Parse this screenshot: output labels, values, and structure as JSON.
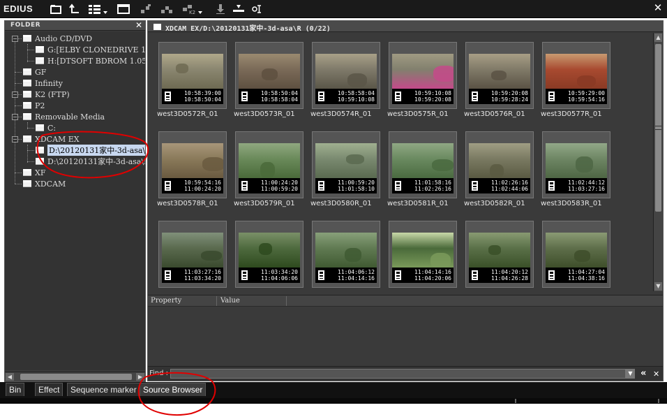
{
  "app": {
    "title": "EDIUS",
    "close_glyph": "✕"
  },
  "toolbar": {
    "icons": [
      "folder-open-icon",
      "up-folder-icon",
      "view-mode-icon",
      "window-icon",
      "add-to-bin-icon",
      "transfer-icon",
      "k2-icon",
      "import-icon",
      "insert-icon",
      "settings-icon"
    ]
  },
  "folder_panel": {
    "title": "FOLDER",
    "close_glyph": "✕",
    "tree": [
      {
        "label": "Audio CD/DVD",
        "level": 0,
        "expandable": true
      },
      {
        "label": "G:[ELBY CLONEDRIVE 1.4",
        "level": 1
      },
      {
        "label": "H:[DTSOFT BDROM 1.05]",
        "level": 1
      },
      {
        "label": "GF",
        "level": 0
      },
      {
        "label": "Infinity",
        "level": 0
      },
      {
        "label": "K2 (FTP)",
        "level": 0,
        "expandable": true
      },
      {
        "label": "P2",
        "level": 0
      },
      {
        "label": "Removable Media",
        "level": 0,
        "expandable": true
      },
      {
        "label": "C:",
        "level": 1
      },
      {
        "label": "XDCAM EX",
        "level": 0,
        "expandable": true
      },
      {
        "label": "D:\\20120131家中-3d-asa\\R",
        "level": 1,
        "selected": true
      },
      {
        "label": "D:\\20120131家中-3d-asa\\L",
        "level": 1
      },
      {
        "label": "XF",
        "level": 0
      },
      {
        "label": "XDCAM",
        "level": 0
      }
    ]
  },
  "browser": {
    "path": "XDCAM EX/D:\\20120131家中-3d-asa\\R (0/22)",
    "clips": [
      {
        "name": "west3D0572R_01",
        "tc_in": "10:58:39:00",
        "tc_out": "10:58:50:04"
      },
      {
        "name": "west3D0573R_01",
        "tc_in": "10:58:50:04",
        "tc_out": "10:58:58:04"
      },
      {
        "name": "west3D0574R_01",
        "tc_in": "10:58:58:04",
        "tc_out": "10:59:10:08"
      },
      {
        "name": "west3D0575R_01",
        "tc_in": "10:59:10:08",
        "tc_out": "10:59:20:08"
      },
      {
        "name": "west3D0576R_01",
        "tc_in": "10:59:20:08",
        "tc_out": "10:59:28:24"
      },
      {
        "name": "west3D0577R_01",
        "tc_in": "10:59:29:00",
        "tc_out": "10:59:54:16"
      },
      {
        "name": "west3D0578R_01",
        "tc_in": "10:59:54:16",
        "tc_out": "11:00:24:20"
      },
      {
        "name": "west3D0579R_01",
        "tc_in": "11:00:24:20",
        "tc_out": "11:00:59:20"
      },
      {
        "name": "west3D0580R_01",
        "tc_in": "11:00:59:20",
        "tc_out": "11:01:58:10"
      },
      {
        "name": "west3D0581R_01",
        "tc_in": "11:01:58:16",
        "tc_out": "11:02:26:16"
      },
      {
        "name": "west3D0582R_01",
        "tc_in": "11:02:26:16",
        "tc_out": "11:02:44:06"
      },
      {
        "name": "west3D0583R_01",
        "tc_in": "11:02:44:12",
        "tc_out": "11:03:27:16"
      },
      {
        "name": "",
        "tc_in": "11:03:27:16",
        "tc_out": "11:03:34:20"
      },
      {
        "name": "",
        "tc_in": "11:03:34:20",
        "tc_out": "11:04:06:06"
      },
      {
        "name": "",
        "tc_in": "11:04:06:12",
        "tc_out": "11:04:14:16"
      },
      {
        "name": "",
        "tc_in": "11:04:14:16",
        "tc_out": "11:04:20:06"
      },
      {
        "name": "",
        "tc_in": "11:04:20:12",
        "tc_out": "11:04:26:28"
      },
      {
        "name": "",
        "tc_in": "11:04:27:04",
        "tc_out": "11:04:38:16"
      }
    ]
  },
  "properties": {
    "col_property": "Property",
    "col_value": "Value"
  },
  "find": {
    "label": "Find :",
    "value": "",
    "rewind_glyph": "«",
    "close_glyph": "✕"
  },
  "tabs": [
    {
      "label": "Bin",
      "active": false
    },
    {
      "label": "Effect",
      "active": false
    },
    {
      "label": "Sequence marker",
      "active": false
    },
    {
      "label": "Source Browser",
      "active": true
    }
  ],
  "colors": {
    "annotation": "#e00000",
    "panel": "#3a3a3a",
    "selection": "#c8d8f0"
  }
}
